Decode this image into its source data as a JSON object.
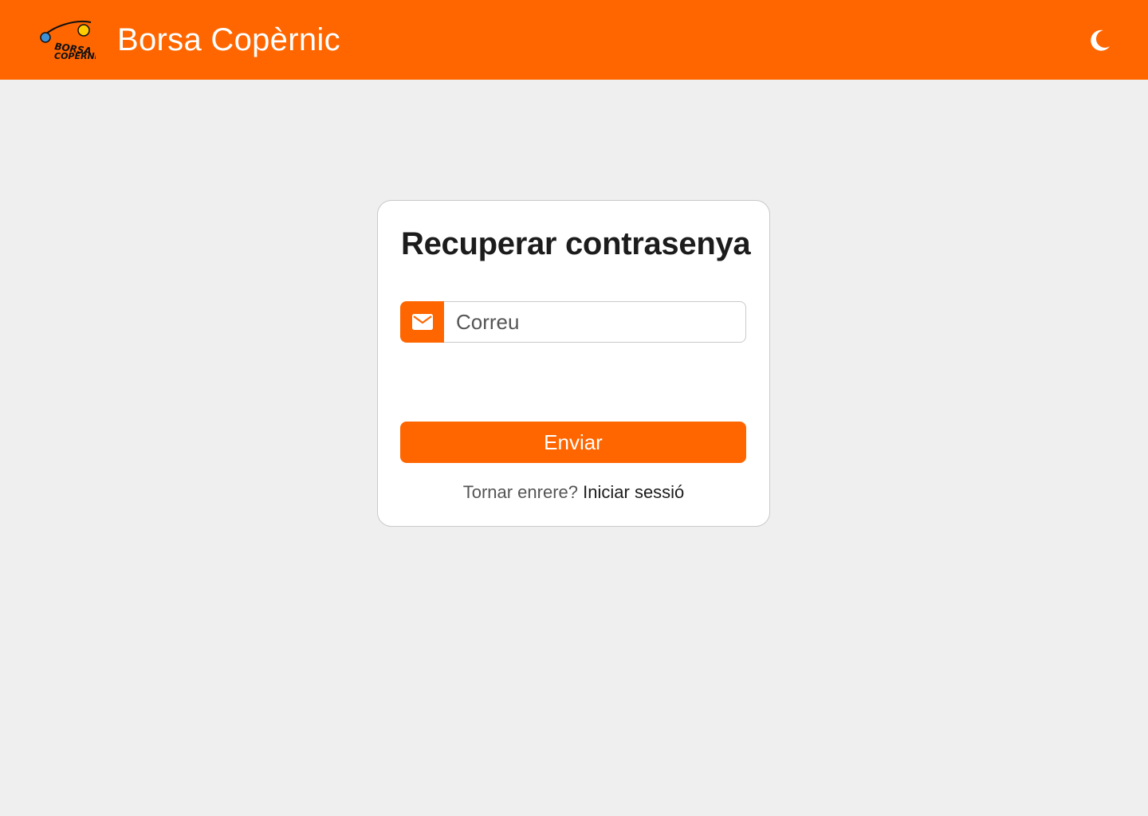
{
  "header": {
    "app_title": "Borsa Copèrnic",
    "logo_text": "Borsa Copèrnic",
    "theme_toggle_icon": "moon-icon"
  },
  "recover": {
    "title": "Recuperar contrasenya",
    "email": {
      "icon": "envelope-icon",
      "placeholder": "Correu",
      "value": ""
    },
    "submit_label": "Enviar",
    "back_prompt": "Tornar enrere?",
    "login_link": "Iniciar sessió"
  },
  "colors": {
    "brand": "#ff6600",
    "background": "#efefef",
    "card": "#ffffff",
    "text": "#1c1c1c",
    "muted": "#555555"
  }
}
